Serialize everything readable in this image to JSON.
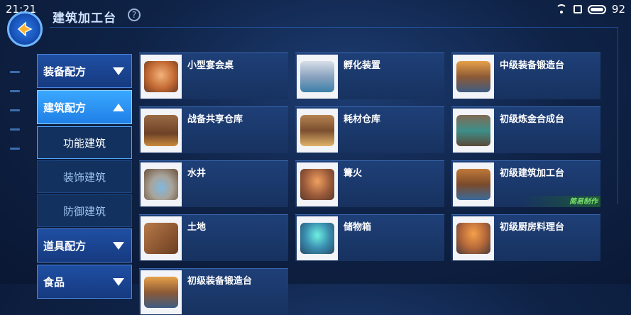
{
  "status": {
    "time": "21:21",
    "battery": "92"
  },
  "header": {
    "title": "建筑加工台",
    "help": "?"
  },
  "menu": {
    "categories": [
      {
        "label": "装备配方"
      },
      {
        "label": "建筑配方"
      },
      {
        "label": "道具配方"
      },
      {
        "label": "食品"
      }
    ],
    "subs": [
      "功能建筑",
      "装饰建筑",
      "防御建筑"
    ]
  },
  "items": [
    {
      "name": "小型宴会桌"
    },
    {
      "name": "孵化装置"
    },
    {
      "name": "中级装备锻造台"
    },
    {
      "name": "战备共享仓库"
    },
    {
      "name": "耗材仓库"
    },
    {
      "name": "初级炼金合成台"
    },
    {
      "name": "水井"
    },
    {
      "name": "篝火"
    },
    {
      "name": "初级建筑加工台",
      "tag": "简易制作"
    },
    {
      "name": "土地"
    },
    {
      "name": "储物箱"
    },
    {
      "name": "初级厨房料理台"
    },
    {
      "name": "初级装备锻造台"
    }
  ],
  "icons": [
    "table-icon",
    "incubator-icon",
    "forge-icon",
    "warehouse-icon",
    "supply-crate-icon",
    "alchemy-icon",
    "well-icon",
    "campfire-icon",
    "workbench-icon",
    "soil-icon",
    "storage-box-icon",
    "kitchen-icon",
    "forge-icon"
  ],
  "colors": {
    "accent": "#1f7fe6",
    "tag": "#7be36a"
  }
}
